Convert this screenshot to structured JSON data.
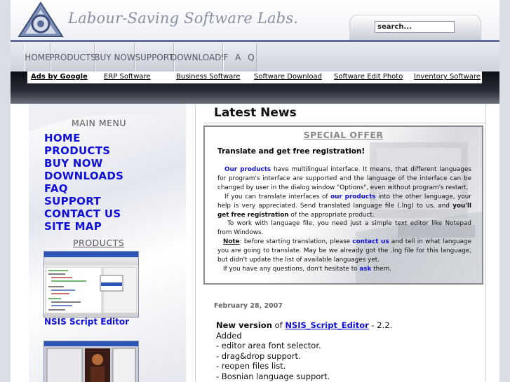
{
  "header": {
    "site_title": "Labour-Saving Software Labs.",
    "search_value": "search..."
  },
  "nav": {
    "tabs": [
      "HOME",
      "PRODUCTS",
      "BUY NOW",
      "SUPPORT",
      "DOWNLOADS",
      "F A Q"
    ]
  },
  "ads": {
    "ads_by": "Ads by Google",
    "links": [
      "ERP Software",
      "Business Software",
      "Software Download",
      "Software Edit Photo",
      "Inventory Software"
    ]
  },
  "sidebar": {
    "main_menu_title": "MAIN MENU",
    "menu_items": [
      "HOME",
      "PRODUCTS",
      "BUY NOW",
      "DOWNLOADS",
      "FAQ",
      "SUPPORT",
      "CONTACT US",
      "SITE MAP"
    ],
    "products_title": "PRODUCTS",
    "product_caption": "NSIS Script Editor"
  },
  "main": {
    "latest_news_title": "Latest News",
    "offer": {
      "title": "SPECIAL OFFER",
      "headline": "Translate and get free registration!",
      "p1_link": "Our products",
      "p1_text": " have multilingual interface. It means, that different languages for program's interface are supported and the language of the interface can be changed by user in the dialog window \"Options\", even without program's restart.",
      "p2_a": "If you can translate interfaces of ",
      "p2_link": "our products",
      "p2_b": " into the other language, your help is very appreciated. Send translated language file (.lng) to us, and ",
      "p2_bold": "you'll get free registration",
      "p2_c": " of the appropriate product.",
      "p3": "To work with language file, you need just a simple text editor like Notepad from Windows.",
      "p4_note": "Note",
      "p4_a": ": before starting translation, please ",
      "p4_link": "contact us",
      "p4_b": " and tell in what language you are going to translate. May be we already got the .lng file for this language, but didn't update the list of available languages yet.",
      "p5_a": "If you have any questions, don't hesitate to ",
      "p5_link": "ask",
      "p5_b": " them."
    },
    "news": {
      "date": "February 28, 2007",
      "new_version_label": "New version",
      "of_text": " of ",
      "product_link": "NSIS_Script_Editor",
      "version_text": " - 2.2.",
      "added": "Added",
      "items": [
        "- editor area font selector.",
        "- drag&drop support.",
        "- reopen files list.",
        "- Bosnian language support."
      ]
    }
  }
}
